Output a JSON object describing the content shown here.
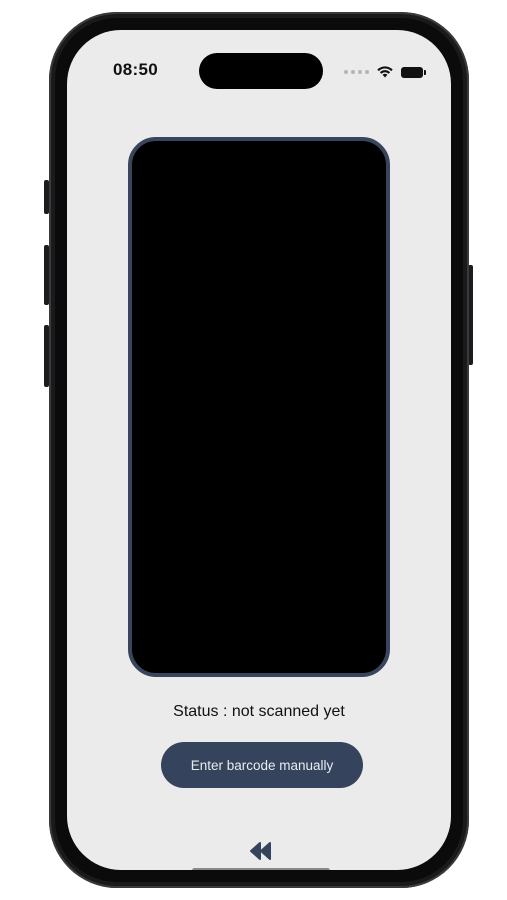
{
  "status_bar": {
    "time": "08:50"
  },
  "scanner": {
    "status_text": "Status : not scanned yet",
    "manual_button_label": "Enter barcode manually"
  },
  "icons": {
    "wifi": "wifi-icon",
    "battery": "battery-icon",
    "back": "rewind-icon"
  },
  "colors": {
    "screen_background": "#ebebeb",
    "accent": "#36435c",
    "camera_border": "#38455c"
  }
}
